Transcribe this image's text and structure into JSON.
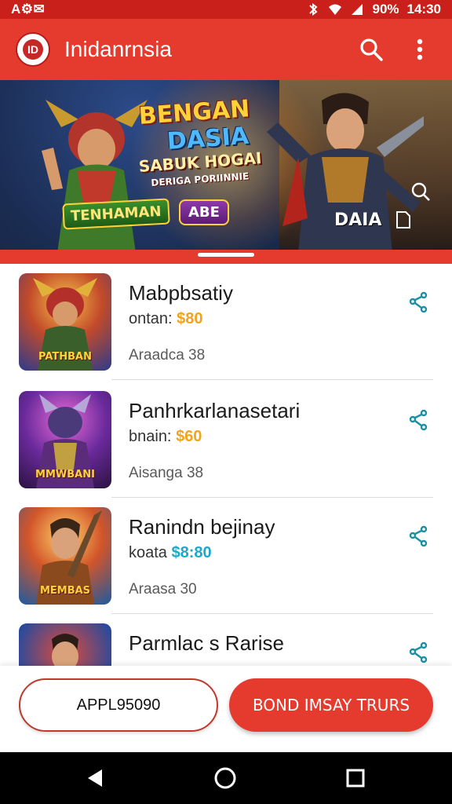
{
  "status_bar": {
    "left_text": "A⚙✉",
    "battery": "90%",
    "time": "14:30"
  },
  "app_bar": {
    "title": "Inidanrnsia",
    "logo_text": "ID",
    "icons": [
      "search-icon",
      "more-vert-icon"
    ]
  },
  "banner": {
    "title_line1": "BENGAN",
    "title_line2": "DASIA",
    "subtitle": "SABUK HOGAI",
    "subtitle2": "DERIGA PORIINNIE",
    "tag_left": "TENHAMAN",
    "tag_mid": "ABE",
    "right_label": "DAIA"
  },
  "list": {
    "items": [
      {
        "name": "Mabpbsatiy",
        "price_label": "ontan:",
        "price": "$80",
        "meta": "Araadca 38",
        "thumb_label": "PATHBAN"
      },
      {
        "name": "Panhrkarlanasetari",
        "price_label": "bnain:",
        "price": "$60",
        "meta": "Aisanga 38",
        "thumb_label": "MMWBANI"
      },
      {
        "name": "Ranindn bejinay",
        "price_label": "koata",
        "price": "$8:80",
        "meta": "Araasa 30",
        "thumb_label": "MEMBAS"
      },
      {
        "name": "Parmlac s Rarise",
        "price_label": "",
        "price": "",
        "meta": "",
        "thumb_label": ""
      }
    ]
  },
  "actions": {
    "secondary_label": "APPL95090",
    "primary_label": "BOND IMSAY TRURS"
  },
  "colors": {
    "primary_red": "#e53b2f",
    "status_red": "#c9201c",
    "price_orange": "#f2a31a",
    "price_teal": "#19a9c9"
  }
}
